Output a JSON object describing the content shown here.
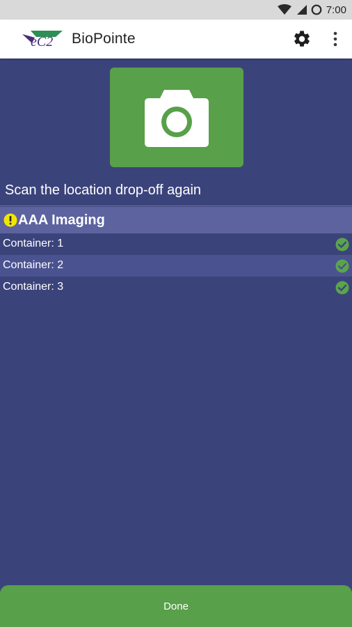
{
  "status_bar": {
    "time": "7:00",
    "icons": [
      "wifi-icon",
      "signal-icon",
      "battery-icon"
    ]
  },
  "app_bar": {
    "logo_text": "eC2",
    "title": "BioPointe",
    "actions": [
      "gear-icon",
      "more-vert-icon"
    ]
  },
  "camera": {
    "icon": "camera-icon"
  },
  "instruction": "Scan the location drop-off again",
  "group": {
    "icon": "warning-icon",
    "title": "AAA Imaging"
  },
  "containers": [
    {
      "label": "Container: 1",
      "status": "check-circle-icon"
    },
    {
      "label": "Container: 2",
      "status": "check-circle-icon"
    },
    {
      "label": "Container: 3",
      "status": "check-circle-icon"
    }
  ],
  "footer": {
    "done_label": "Done"
  },
  "colors": {
    "background": "#3b437b",
    "accent_green": "#58a04a",
    "group_header": "#5c639f",
    "row_alt": "#4a5290",
    "warning_yellow": "#f2e600"
  }
}
